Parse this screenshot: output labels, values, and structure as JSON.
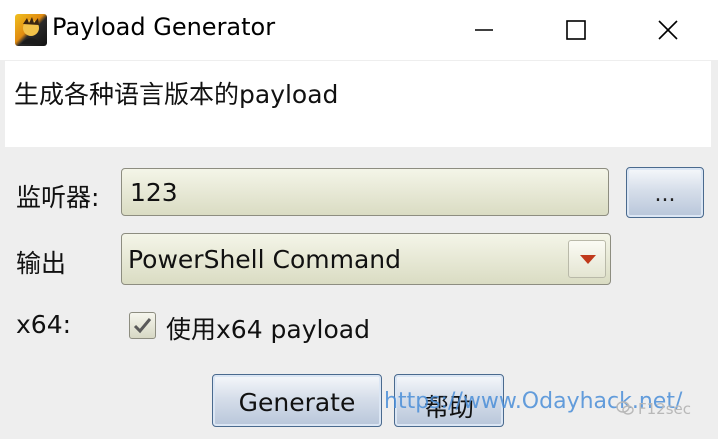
{
  "window": {
    "title": "Payload Generator",
    "icon": "app-icon"
  },
  "description": "生成各种语言版本的payload",
  "form": {
    "listener_label": "监听器:",
    "listener_value": "123",
    "browse_label": "...",
    "output_label": "输出",
    "output_value": "PowerShell Command",
    "x64_label": "x64:",
    "x64_checkbox_label": "使用x64 payload",
    "x64_checked": true
  },
  "buttons": {
    "generate": "Generate",
    "help": "帮助"
  },
  "watermark": {
    "url": "https://www.Odayhack.net/",
    "brand": "F12sec"
  },
  "colors": {
    "field_top": "#f4f5e8",
    "field_bottom": "#dadcc3",
    "button_border": "#4a6a8e",
    "arrow_red": "#c0391b",
    "watermark_blue": "#4a8ed8"
  }
}
